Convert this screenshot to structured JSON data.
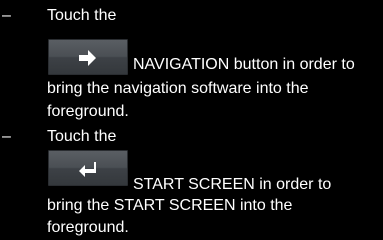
{
  "items": [
    {
      "bullet": "–",
      "intro": "Touch the",
      "button": {
        "icon": "arrow-right-icon"
      },
      "line1": "NAVIGATION button in order to",
      "line2": "bring the navigation software into the",
      "line3": "foreground."
    },
    {
      "bullet": "–",
      "intro": "Touch the",
      "button": {
        "icon": "return-arrow-icon"
      },
      "line1": "START SCREEN in order to",
      "line2": "bring the START SCREEN into the",
      "line3": "foreground."
    }
  ],
  "colors": {
    "background": "#000000",
    "text": "#ffffff",
    "button_face": "#4a4f54"
  }
}
